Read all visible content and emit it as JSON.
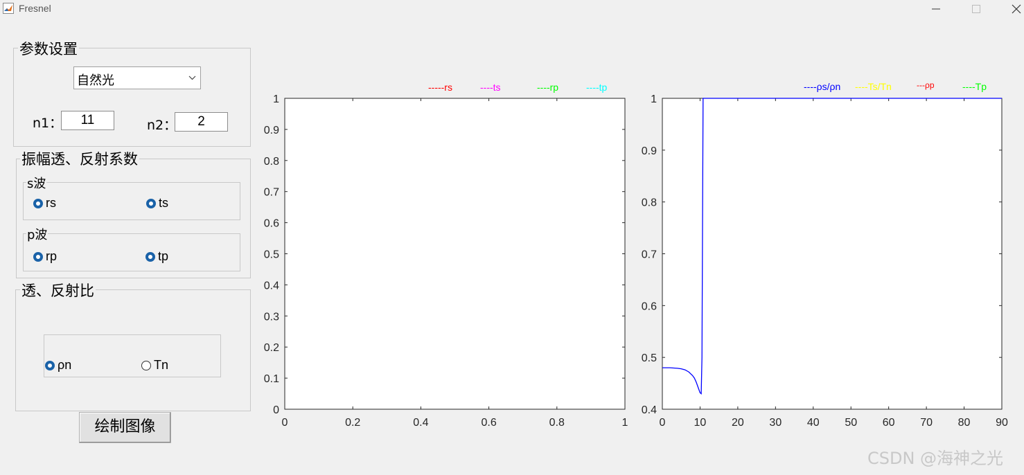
{
  "window": {
    "title": "Fresnel"
  },
  "params_panel": {
    "title": "参数设置",
    "light_type": "自然光",
    "n1_label": "n1：",
    "n1_value": "11",
    "n2_label": "n2：",
    "n2_value": "2"
  },
  "amplitude_panel": {
    "title": "振幅透、反射系数",
    "s_group": {
      "title": "s波",
      "options": [
        "rs",
        "ts"
      ],
      "checked": [
        true,
        true
      ]
    },
    "p_group": {
      "title": "p波",
      "options": [
        "rp",
        "tp"
      ],
      "checked": [
        true,
        true
      ]
    }
  },
  "ratio_panel": {
    "title": "透、反射比",
    "options": [
      "ρn",
      "Tn"
    ],
    "checked": [
      true,
      false
    ]
  },
  "draw_button": "绘制图像",
  "legend_left": [
    {
      "label": "-----rs",
      "color": "#ff0000"
    },
    {
      "label": "----ts",
      "color": "#ff00ff"
    },
    {
      "label": "----rp",
      "color": "#00ff00"
    },
    {
      "label": "----tp",
      "color": "#00ffff"
    }
  ],
  "legend_right": [
    {
      "label": "----ρs/ρn",
      "color": "#0000ff"
    },
    {
      "label": "----Ts/Tn",
      "color": "#ffff00"
    },
    {
      "label": "---ρp",
      "color": "#ff0000"
    },
    {
      "label": "----Tp",
      "color": "#00ff00"
    }
  ],
  "watermark": "CSDN @海神之光",
  "chart_data": [
    {
      "type": "line",
      "xlim": [
        0,
        1
      ],
      "ylim": [
        0,
        1
      ],
      "xticks": [
        "0",
        "0.2",
        "0.4",
        "0.6",
        "0.8",
        "1"
      ],
      "yticks": [
        "0",
        "0.1",
        "0.2",
        "0.3",
        "0.4",
        "0.5",
        "0.6",
        "0.7",
        "0.8",
        "0.9",
        "1"
      ],
      "series": []
    },
    {
      "type": "line",
      "xlim": [
        0,
        90
      ],
      "ylim": [
        0.4,
        1
      ],
      "xticks": [
        "0",
        "10",
        "20",
        "30",
        "40",
        "50",
        "60",
        "70",
        "80",
        "90"
      ],
      "yticks": [
        "0.4",
        "0.5",
        "0.6",
        "0.7",
        "0.8",
        "0.9",
        "1"
      ],
      "series": [
        {
          "name": "----ρs/ρn",
          "color": "#0000ff",
          "x": [
            0,
            2,
            4,
            5,
            6,
            7,
            8,
            8.5,
            9,
            9.5,
            10,
            10.3,
            10.5,
            10.8,
            90
          ],
          "y": [
            0.48,
            0.48,
            0.479,
            0.478,
            0.476,
            0.472,
            0.465,
            0.46,
            0.452,
            0.442,
            0.432,
            0.43,
            0.5,
            1,
            1
          ]
        }
      ]
    }
  ]
}
